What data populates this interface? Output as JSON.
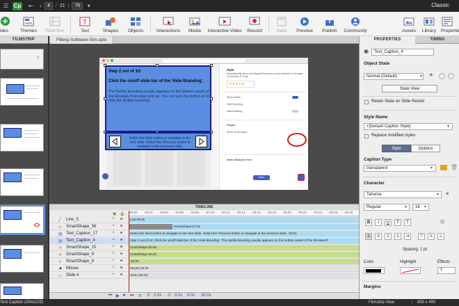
{
  "titlebar": {
    "logo": "Cp",
    "current_page": "4",
    "total_pages": "21",
    "zoom": "75",
    "mode": "Classic"
  },
  "toolbar": {
    "items": [
      {
        "label": "Slides",
        "icon": "slides-icon"
      },
      {
        "label": "Themes",
        "icon": "themes-icon"
      },
      {
        "label": "Fluid Box",
        "icon": "fluid-box-icon",
        "disabled": true
      },
      {
        "label": "Text",
        "icon": "text-icon"
      },
      {
        "label": "Shapes",
        "icon": "shapes-icon"
      },
      {
        "label": "Objects",
        "icon": "objects-icon"
      },
      {
        "label": "Interactions",
        "icon": "interactions-icon"
      },
      {
        "label": "Media",
        "icon": "media-icon"
      },
      {
        "label": "Interactive Video",
        "icon": "interactive-video-icon"
      },
      {
        "label": "Record",
        "icon": "record-icon"
      },
      {
        "label": "Save",
        "icon": "save-icon",
        "disabled": true
      },
      {
        "label": "Preview",
        "icon": "preview-icon"
      },
      {
        "label": "Publish",
        "icon": "publish-icon"
      },
      {
        "label": "Community",
        "icon": "community-icon"
      },
      {
        "label": "Assets",
        "icon": "assets-icon"
      },
      {
        "label": "Library",
        "icon": "library-icon"
      },
      {
        "label": "Properties",
        "icon": "properties-icon"
      }
    ]
  },
  "filmstrip": {
    "header": "FILMSTRIP"
  },
  "document": {
    "tab": "FBerg-Software-Sim.cptx"
  },
  "slide": {
    "caption_line1": "Step 2 out of 10:",
    "caption_line2": "Click the on/off slide bar of the 'Hide Branding'.",
    "caption_body": "The Notifia branding usually appears on the bottom center of the Reviews Promotion pop up. You can turn the button on to hide the Notifia branding.",
    "nav_text": "Select the Next button to navigate to the next slide. Select the Previous button to navigate to the previous slide.",
    "panel_heading": "Reviews Promotion",
    "panel_sub": "Automatically show and display Reviews on your website to increase Conversion & Trust",
    "panel_labels": [
      "Style",
      "Show Notice",
      "Hide Branding",
      "Watermarking",
      "Trigger",
      "Show on all pages",
      "North Shadows Feed",
      "Save"
    ]
  },
  "timeline": {
    "header": "TIMELINE",
    "ruler": [
      "00:00",
      "00:02",
      "00:04",
      "00:06",
      "00:08",
      "00:10",
      "00:12",
      "00:14",
      "00:16",
      "00:18",
      "00:20",
      "00:22",
      "00:24",
      "00:26",
      "00:28"
    ],
    "rows": [
      {
        "name": "Line_5",
        "icon": "line-icon",
        "bar": "Line:30.0s",
        "color": "#a9dcf2",
        "start": 0,
        "width": 1
      },
      {
        "name": "SmartShape_56",
        "icon": "star-icon",
        "bar": "SmartShape:27.0s",
        "color": "#a9dcf2",
        "start": 0.19,
        "width": 0.81,
        "pre": "#8c8c8c"
      },
      {
        "name": "Text_Caption_17",
        "icon": "caption-icon",
        "bar": "Select the Next button to navigate to the next slide. Select the Previous button to navigate to the previous slide. :30.0s",
        "color": "#a9dcf2",
        "start": 0,
        "width": 1
      },
      {
        "name": "Text_Caption_4",
        "icon": "caption-icon",
        "bar": "Step 2 out of 10:  Click the on/off slide bar of the 'Hide Branding'.   The Notifia branding usually appears on the bottom center of the Reviews P",
        "color": "#a9dcf2",
        "start": 0,
        "width": 1,
        "selected": true
      },
      {
        "name": "SmartShape_10",
        "icon": "star-icon",
        "bar": "SmartShape:30.0s",
        "color": "#c6dc8c",
        "start": 0,
        "width": 1
      },
      {
        "name": "SmartShape_9",
        "icon": "star-icon",
        "bar": "SmartShape:30.0s",
        "color": "#c6dc8c",
        "start": 0,
        "width": 1
      },
      {
        "name": "SmartShape_8",
        "icon": "star-icon",
        "bar": ":30.0s",
        "color": "#c6dc8c",
        "start": 0,
        "width": 1
      },
      {
        "name": "Mouse",
        "icon": "mouse-icon",
        "bar": "Mouse:30.0s",
        "color": "#e0e0e0",
        "start": 0,
        "width": 1
      },
      {
        "name": "Slide 4",
        "icon": "slide-icon",
        "bar": "Slide (30.0s)",
        "color": "#e0e0e0",
        "start": 0,
        "width": 1
      }
    ],
    "footer_time1": "0.0s",
    "footer_time2": "0.0s",
    "footer_time3": "0.0s",
    "footer_time4": "30.0s"
  },
  "properties": {
    "tab_properties": "PROPERTIES",
    "tab_timing": "TIMING",
    "object_name": "Text_Caption_4",
    "object_state_label": "Object State",
    "state_value": "Normal (Default)",
    "state_view_button": "State View",
    "retain_state": "Retain State on Slide Revisit",
    "style_name_label": "Style Name",
    "style_value": "+[Default Caption Style]",
    "replace_styles": "Replace modified styles",
    "style_tab": "Style",
    "options_tab": "Options",
    "caption_type_label": "Caption Type",
    "caption_type": "transparent",
    "character_label": "Character",
    "font": "Tahoma",
    "weight": "Regular",
    "size": "16",
    "spacing": "Spacing: 1 pt",
    "color_label": "Color",
    "highlight_label": "Highlight",
    "effects_label": "Effects",
    "effects_value": "T",
    "margins_label": "Margins",
    "format_buttons": [
      "B",
      "I",
      "U",
      "T",
      "T"
    ]
  },
  "status": {
    "left": "Text Caption (394x229)",
    "view": "Filmstrip View",
    "size": "800 x 490"
  }
}
